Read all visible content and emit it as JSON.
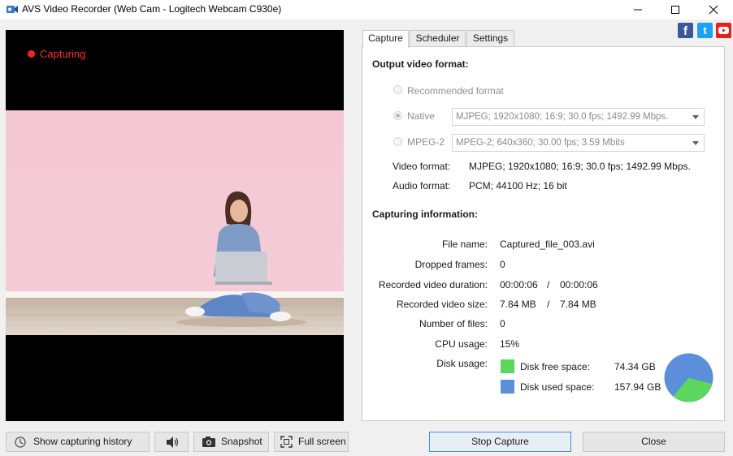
{
  "window": {
    "title": "AVS Video Recorder (Web Cam - Logitech Webcam C930e)"
  },
  "preview": {
    "status_label": "Capturing",
    "status_color": "#ff2a2a"
  },
  "tabs": [
    {
      "label": "Capture",
      "active": true
    },
    {
      "label": "Scheduler",
      "active": false
    },
    {
      "label": "Settings",
      "active": false
    }
  ],
  "social": {
    "facebook": "f",
    "twitter": "t"
  },
  "output": {
    "heading": "Output video format:",
    "recommended_label": "Recommended format",
    "native_label": "Native",
    "native_value": "MJPEG; 1920x1080; 16:9; 30.0 fps; 1492.99 Mbps.",
    "mpeg2_label": "MPEG-2",
    "mpeg2_value": "MPEG-2; 640x360; 30.00 fps; 3.59 Mbits",
    "video_format_label": "Video format:",
    "video_format_value": "MJPEG; 1920x1080; 16:9; 30.0 fps; 1492.99 Mbps.",
    "audio_format_label": "Audio format:",
    "audio_format_value": "PCM; 44100 Hz; 16 bit"
  },
  "capturing": {
    "heading": "Capturing information:",
    "file_name_label": "File name:",
    "file_name_value": "Captured_file_003.avi",
    "dropped_label": "Dropped frames:",
    "dropped_value": "0",
    "duration_label": "Recorded video duration:",
    "duration_value": "00:00:06",
    "duration_total": "00:00:06",
    "size_label": "Recorded video size:",
    "size_value": "7.84 MB",
    "size_total": "7.84 MB",
    "separator": "/",
    "files_label": "Number of files:",
    "files_value": "0",
    "cpu_label": "CPU usage:",
    "cpu_value": "15%",
    "disk_label": "Disk usage:",
    "disk_free_label": "Disk free space:",
    "disk_free_value": "74.34 GB",
    "disk_used_label": "Disk used space:",
    "disk_used_value": "157.94 GB",
    "free_color": "#5cd65c",
    "used_color": "#5b8fd9"
  },
  "buttons": {
    "history": "Show capturing history",
    "snapshot": "Snapshot",
    "fullscreen": "Full screen",
    "stop": "Stop Capture",
    "close": "Close"
  }
}
